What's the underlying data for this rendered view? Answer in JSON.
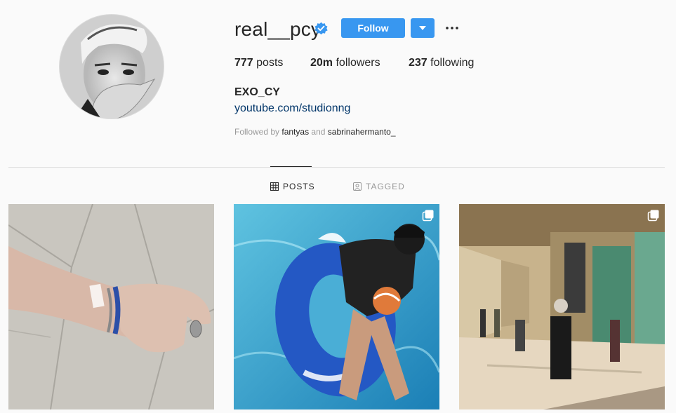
{
  "profile": {
    "username": "real__pcy",
    "verified": true,
    "follow_label": "Follow",
    "full_name": "EXO_CY",
    "link": "youtube.com/studionng",
    "followed_by_prefix": "Followed by",
    "followed_by_user1": "fantyas",
    "followed_by_and": "and",
    "followed_by_user2": "sabrinahermanto_"
  },
  "stats": {
    "posts_count": "777",
    "posts_label": "posts",
    "followers_count": "20m",
    "followers_label": "followers",
    "following_count": "237",
    "following_label": "following"
  },
  "tabs": [
    {
      "label": "POSTS",
      "icon": "grid-icon",
      "active": true
    },
    {
      "label": "TAGGED",
      "icon": "tag-portrait-icon",
      "active": false
    }
  ],
  "posts": [
    {
      "multiple": false
    },
    {
      "multiple": true
    },
    {
      "multiple": true
    }
  ],
  "colors": {
    "accent": "#3897f0",
    "link": "#003569",
    "verified": "#3897f0"
  }
}
